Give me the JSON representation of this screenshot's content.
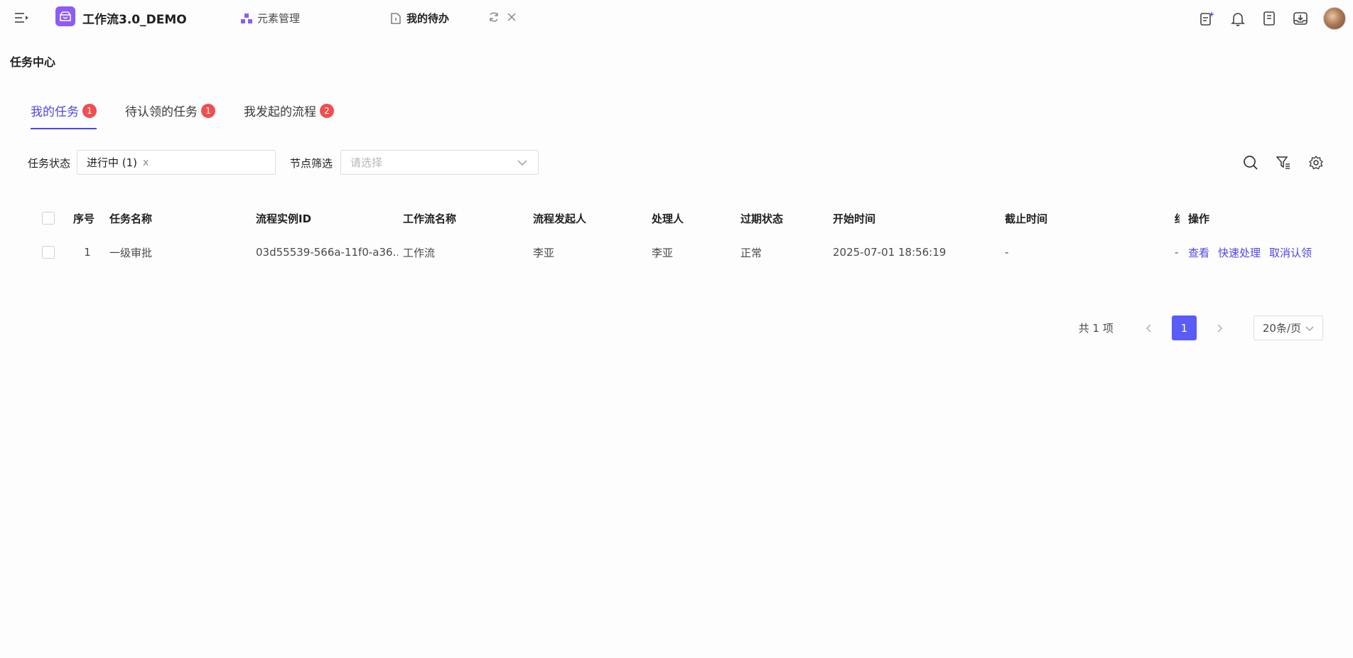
{
  "header": {
    "app_title": "工作流3.0_DEMO",
    "tabs": [
      {
        "label": "元素管理"
      },
      {
        "label": "我的待办"
      }
    ]
  },
  "page": {
    "title": "任务中心"
  },
  "task_tabs": [
    {
      "label": "我的任务",
      "badge": "1"
    },
    {
      "label": "待认领的任务",
      "badge": "1"
    },
    {
      "label": "我发起的流程",
      "badge": "2"
    }
  ],
  "filters": {
    "status_label": "任务状态",
    "status_value": "进行中 (1)",
    "status_clear": "x",
    "node_label": "节点筛选",
    "node_placeholder": "请选择"
  },
  "table": {
    "headers": [
      "序号",
      "任务名称",
      "流程实例ID",
      "工作流名称",
      "流程发起人",
      "处理人",
      "过期状态",
      "开始时间",
      "截止时间",
      "结",
      "操作"
    ],
    "rows": [
      {
        "index": "1",
        "task_name": "一级审批",
        "instance_id": "03d55539-566a-11f0-a36...",
        "workflow_name": "工作流",
        "initiator": "李亚",
        "handler": "李亚",
        "expire_status": "正常",
        "start_time": "2025-07-01 18:56:19",
        "deadline": "-",
        "end": "-",
        "actions": [
          "查看",
          "快速处理",
          "取消认领"
        ]
      }
    ]
  },
  "pagination": {
    "total": "共 1 项",
    "current_page": "1",
    "page_size": "20条/页"
  },
  "colors": {
    "accent": "#4f46e5",
    "badge": "#f04f4f",
    "logo": "#8b5cf6",
    "page_btn": "#5b5bf5"
  }
}
